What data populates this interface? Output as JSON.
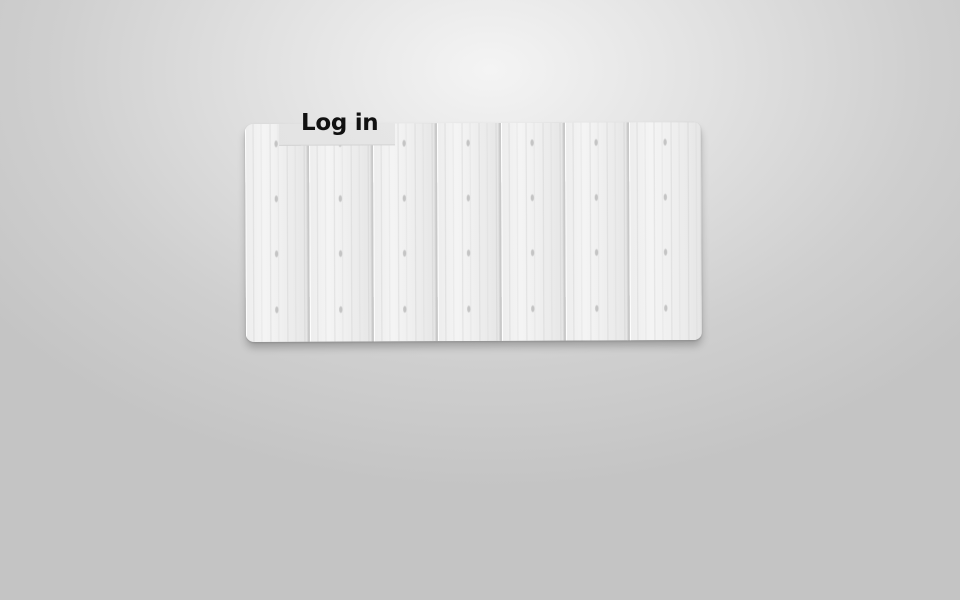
{
  "login_tab": {
    "label": "Log in"
  },
  "board": {
    "plank_count": 7,
    "style": "white-wood-planks"
  },
  "colors": {
    "background_light": "#f4f4f4",
    "background_dark": "#c4c4c4",
    "plank": "#efefef",
    "label": "#111111"
  }
}
